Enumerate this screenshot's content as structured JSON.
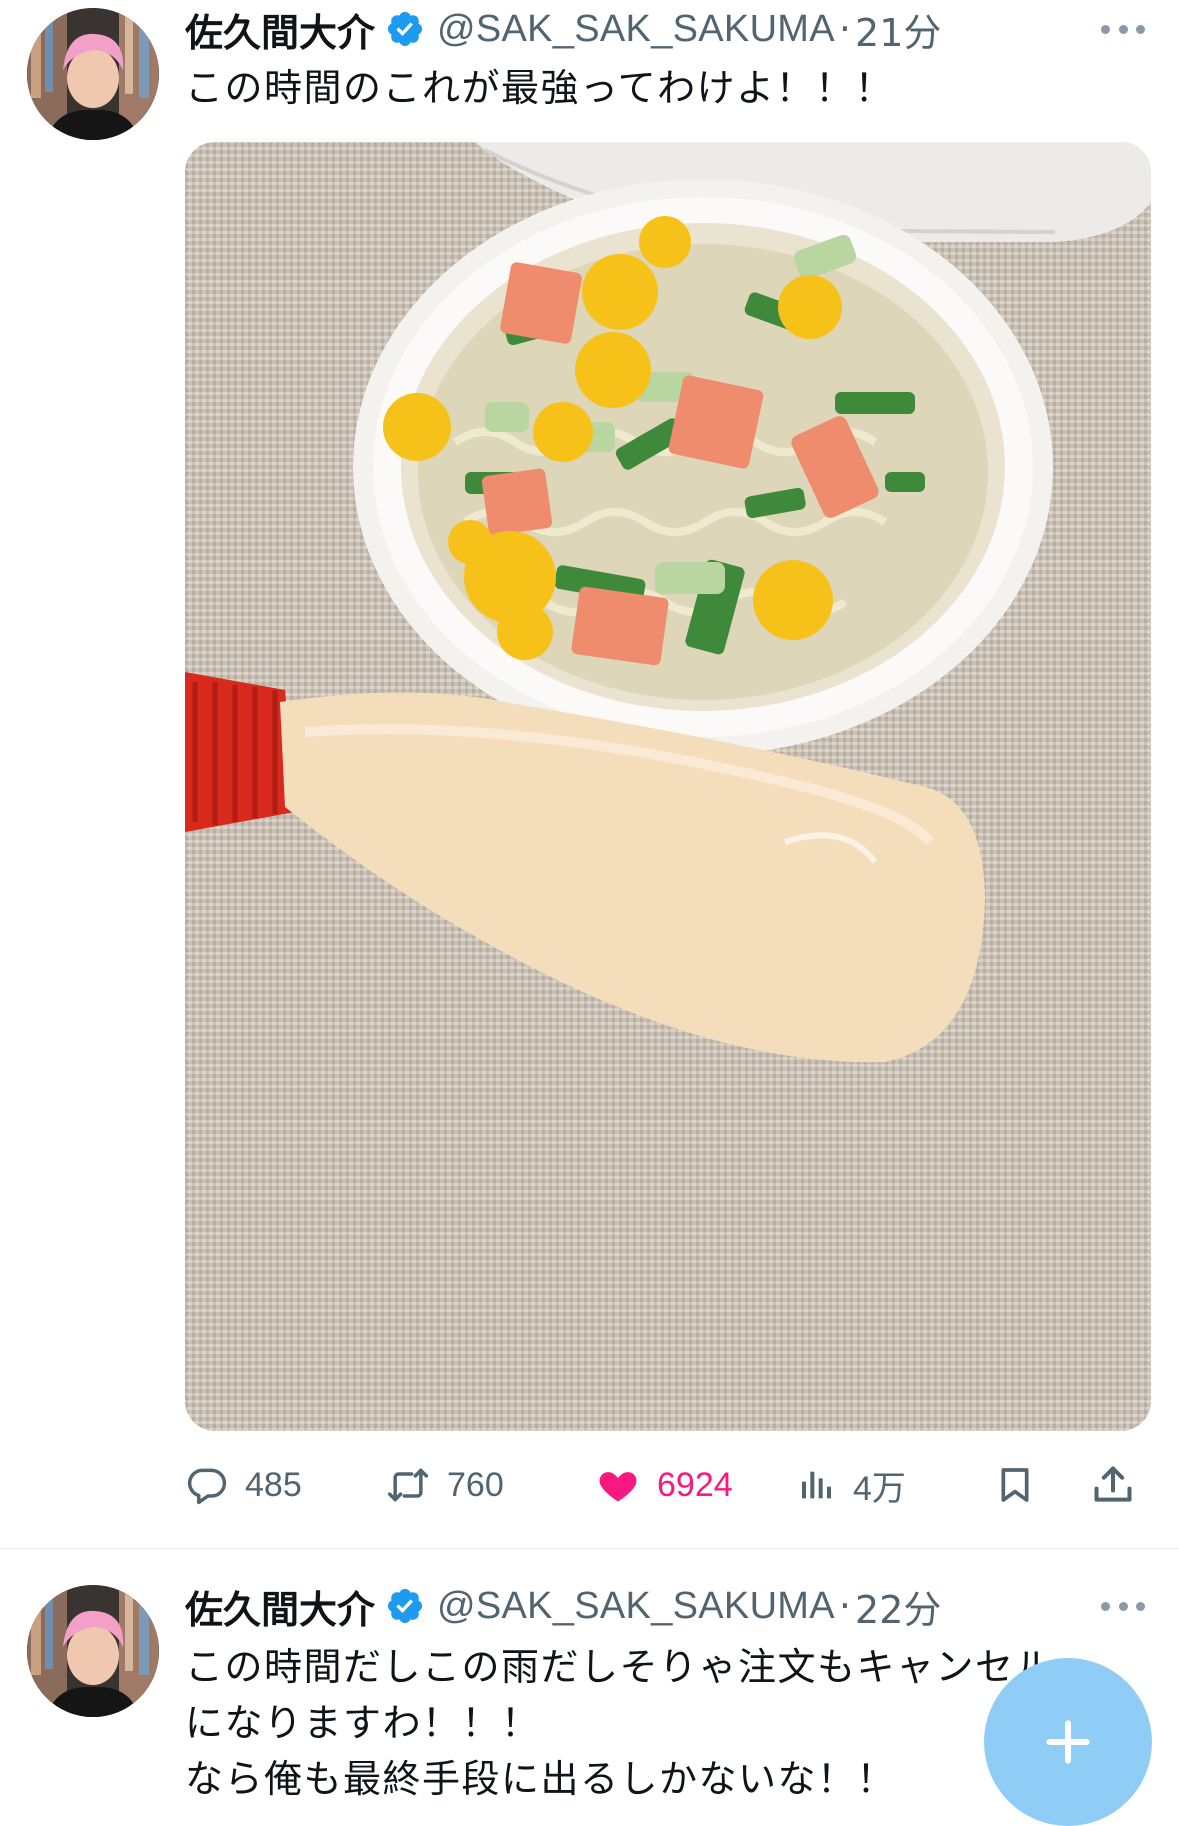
{
  "tweets": [
    {
      "author_name": "佐久間大介",
      "handle": "@SAK_SAK_SAKUMA",
      "separator": "·",
      "time": "21分",
      "text": "この時間のこれが最強ってわけよ！！！",
      "stats": {
        "replies": "485",
        "retweets": "760",
        "likes": "6924",
        "views": "4万"
      },
      "liked": true
    },
    {
      "author_name": "佐久間大介",
      "handle": "@SAK_SAK_SAKUMA",
      "separator": "·",
      "time": "22分",
      "text_lines": [
        "この時間だしこの雨だしそりゃ注文もキャンセル",
        "になりますわ！！！",
        "なら俺も最終手段に出るしかないな！！"
      ]
    }
  ],
  "icons": {
    "verified": "verified-badge-icon",
    "reply": "reply-icon",
    "retweet": "retweet-icon",
    "like": "heart-icon",
    "views": "views-icon",
    "bookmark": "bookmark-icon",
    "share": "share-icon",
    "compose": "plus-icon"
  },
  "colors": {
    "verified": "#1d9bf0",
    "like": "#f91880",
    "secondary_text": "#536471",
    "fab": "#8fcdf7"
  }
}
